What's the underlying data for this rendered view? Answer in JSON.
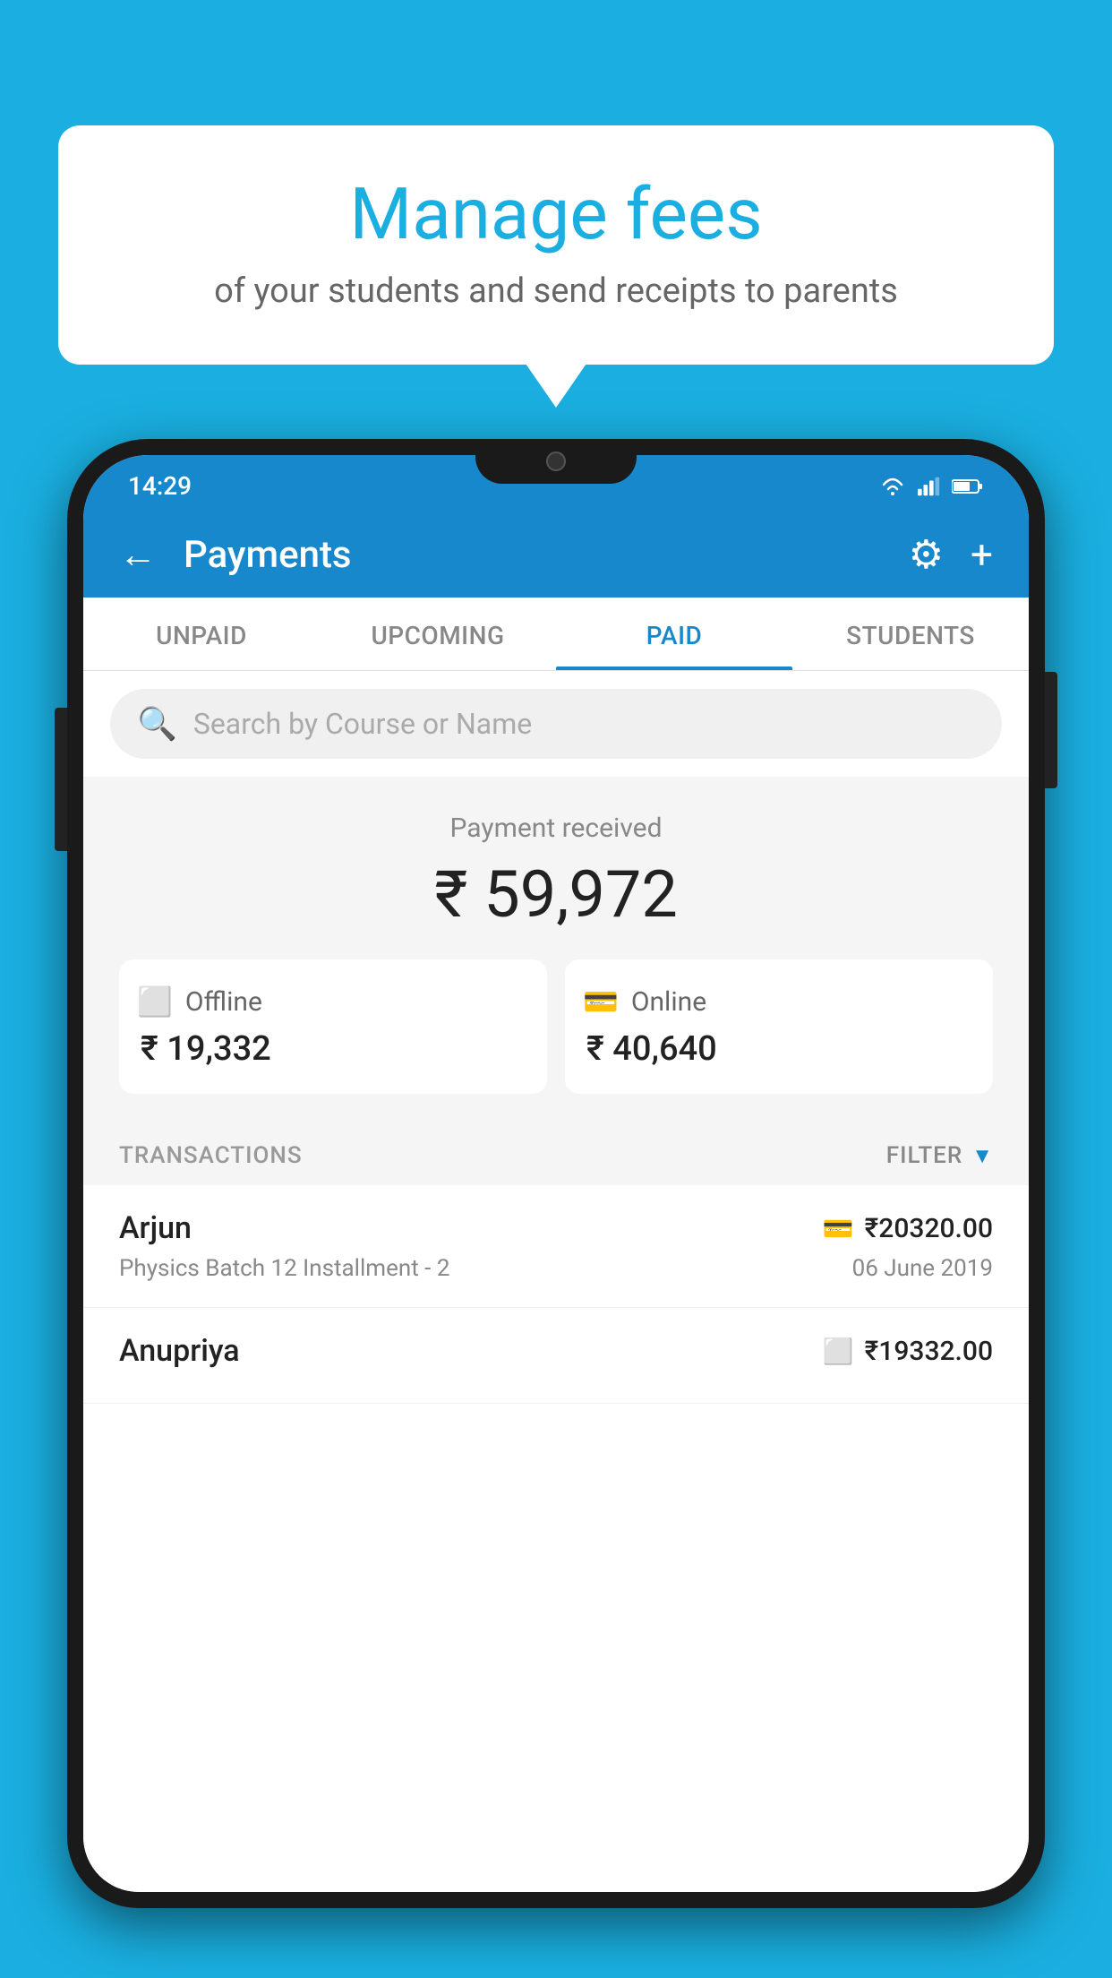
{
  "background": {
    "color": "#1AAFE0"
  },
  "speech_bubble": {
    "title": "Manage fees",
    "subtitle": "of your students and send receipts to parents"
  },
  "status_bar": {
    "time": "14:29"
  },
  "app_bar": {
    "title": "Payments",
    "back_label": "←",
    "gear_label": "⚙",
    "plus_label": "+"
  },
  "tabs": [
    {
      "id": "unpaid",
      "label": "UNPAID",
      "active": false
    },
    {
      "id": "upcoming",
      "label": "UPCOMING",
      "active": false
    },
    {
      "id": "paid",
      "label": "PAID",
      "active": true
    },
    {
      "id": "students",
      "label": "STUDENTS",
      "active": false
    }
  ],
  "search": {
    "placeholder": "Search by Course or Name"
  },
  "payment": {
    "label": "Payment received",
    "amount": "₹ 59,972",
    "offline": {
      "type": "Offline",
      "amount": "₹ 19,332"
    },
    "online": {
      "type": "Online",
      "amount": "₹ 40,640"
    }
  },
  "transactions": {
    "label": "TRANSACTIONS",
    "filter_label": "FILTER",
    "items": [
      {
        "name": "Arjun",
        "amount": "₹20320.00",
        "course": "Physics Batch 12 Installment - 2",
        "date": "06 June 2019",
        "payment_type": "online"
      },
      {
        "name": "Anupriya",
        "amount": "₹19332.00",
        "course": "",
        "date": "",
        "payment_type": "offline"
      }
    ]
  }
}
